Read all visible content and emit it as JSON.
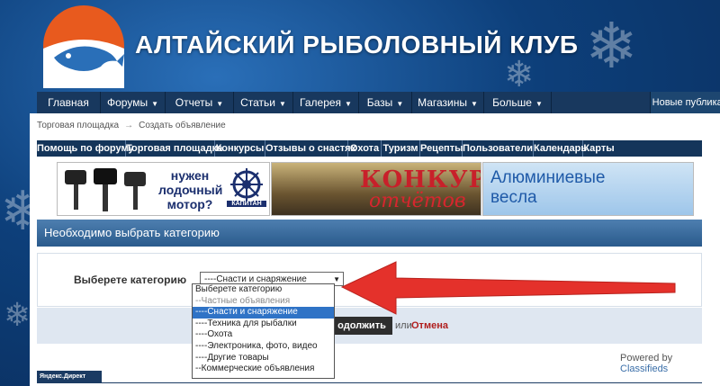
{
  "site": {
    "title": "АЛТАЙСКИЙ РЫБОЛОВНЫЙ КЛУБ"
  },
  "nav": {
    "items": [
      {
        "label": "Главная",
        "has_caret": false
      },
      {
        "label": "Форумы",
        "has_caret": true
      },
      {
        "label": "Отчеты",
        "has_caret": true
      },
      {
        "label": "Статьи",
        "has_caret": true
      },
      {
        "label": "Галерея",
        "has_caret": true
      },
      {
        "label": "Базы",
        "has_caret": true
      },
      {
        "label": "Магазины",
        "has_caret": true
      },
      {
        "label": "Больше",
        "has_caret": true
      }
    ],
    "right_label": "Новые публикации"
  },
  "breadcrumb": {
    "first": "Торговая площадка",
    "separator": "→",
    "current": "Создать объявление"
  },
  "links": [
    "Помощь по форуму",
    "Торговая площадка",
    "Конкурсы",
    "Отзывы о снастях",
    "Охота",
    "Туризм",
    "Рецепты",
    "Пользователи",
    "Календарь",
    "Карты"
  ],
  "banners": {
    "motor": {
      "line1": "нужен",
      "line2": "лодочный",
      "line3": "мотор?",
      "brand": "КАПИТАН"
    },
    "contest": {
      "line1": "КОНКУРС",
      "line2": "отчётов"
    },
    "aluminum": {
      "line1": "Алюминиевые",
      "line2": "весла"
    }
  },
  "category": {
    "header": "Необходимо выбрать категорию",
    "label": "Выберете категорию",
    "selected": "----Снасти и снаряжение",
    "options": [
      {
        "label": "Выберете категорию",
        "style": "normal"
      },
      {
        "label": "--Частные объявления",
        "style": "gray"
      },
      {
        "label": "----Снасти и снаряжение",
        "style": "selected"
      },
      {
        "label": "----Техника для рыбалки",
        "style": "normal"
      },
      {
        "label": "----Охота",
        "style": "normal"
      },
      {
        "label": "----Электроника, фото, видео",
        "style": "normal"
      },
      {
        "label": "----Другие товары",
        "style": "normal"
      },
      {
        "label": "--Коммерческие объявления",
        "style": "normal"
      }
    ]
  },
  "form": {
    "continue_label": "одолжить",
    "or_text": "или",
    "cancel_label": "Отмена"
  },
  "footer": {
    "powered_prefix": "Powered by",
    "powered_name": "Classifieds",
    "ydirect": "Яндекс.Директ"
  },
  "colors": {
    "accent": "#2f73c6",
    "nav": "#18385e",
    "arrow": "#e4312b",
    "cancel": "#b01e1e"
  }
}
